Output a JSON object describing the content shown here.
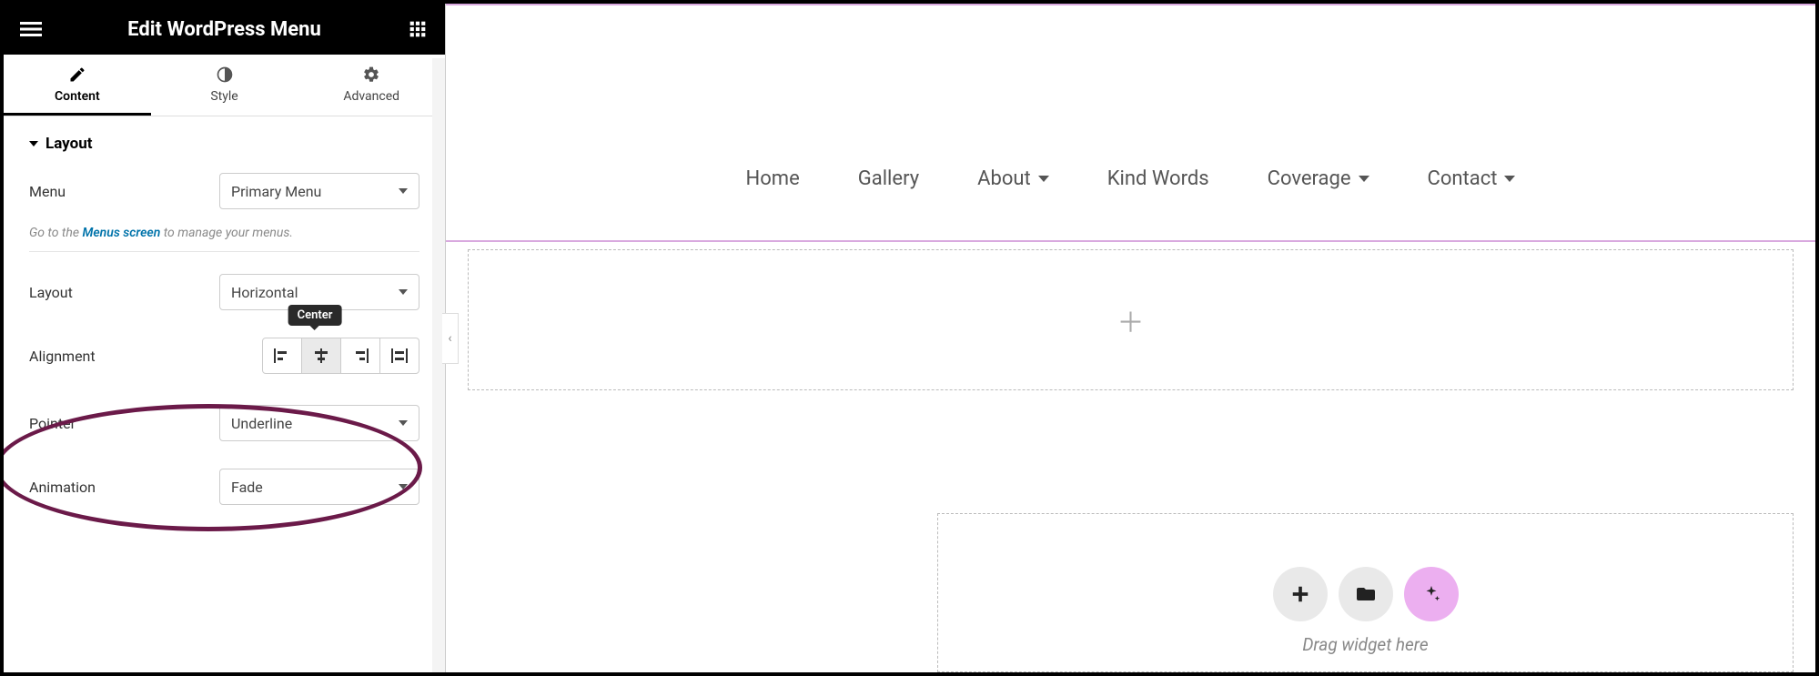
{
  "topbar": {
    "title": "Edit WordPress Menu"
  },
  "tabs": {
    "content": "Content",
    "style": "Style",
    "advanced": "Advanced"
  },
  "layout_section": {
    "title": "Layout",
    "menu_label": "Menu",
    "menu_value": "Primary Menu",
    "help_prefix": "Go to the ",
    "help_link": "Menus screen",
    "help_suffix": " to manage your menus.",
    "layout_label": "Layout",
    "layout_value": "Horizontal",
    "alignment_label": "Alignment",
    "alignment_tooltip": "Center",
    "pointer_label": "Pointer",
    "pointer_value": "Underline",
    "animation_label": "Animation",
    "animation_value": "Fade"
  },
  "preview": {
    "nav_items": [
      {
        "label": "Home",
        "has_dropdown": false
      },
      {
        "label": "Gallery",
        "has_dropdown": false
      },
      {
        "label": "About",
        "has_dropdown": true
      },
      {
        "label": "Kind Words",
        "has_dropdown": false
      },
      {
        "label": "Coverage",
        "has_dropdown": true
      },
      {
        "label": "Contact",
        "has_dropdown": true
      }
    ],
    "drop_hint": "Drag widget here"
  }
}
